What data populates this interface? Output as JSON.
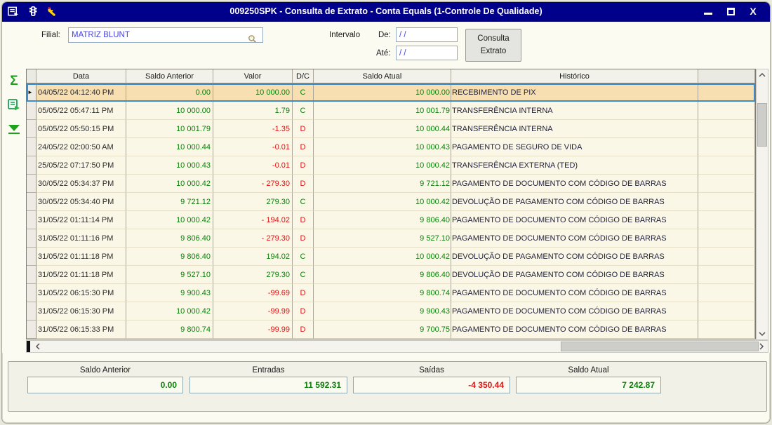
{
  "window": {
    "title": "009250SPK - Consulta de Extrato - Conta Equals (1-Controle De Qualidade)",
    "controls": {
      "close_glyph": "X"
    }
  },
  "colors": {
    "titlebar": "#00008B",
    "positive": "#0B7F0B",
    "negative": "#E01212",
    "selection": "#F7DFB2",
    "input_text": "#4743E0"
  },
  "form": {
    "filial_label": "Filial:",
    "filial_value": "MATRIZ BLUNT",
    "intervalo_label": "Intervalo",
    "de_label": "De:",
    "de_value": "/ /",
    "ate_label": "Até:",
    "ate_value": "/ /",
    "button_line1": "Consulta",
    "button_line2": "Extrato"
  },
  "table": {
    "columns": [
      "Data",
      "Saldo Anterior",
      "Valor",
      "D/C",
      "Saldo Atual",
      "Histórico"
    ],
    "rows": [
      {
        "data": "04/05/22 04:12:40 PM",
        "saldo_anterior": "0.00",
        "valor": "10 000.00",
        "dc": "C",
        "saldo_atual": "10 000.00",
        "historico": "RECEBIMENTO DE PIX",
        "selected": true
      },
      {
        "data": "05/05/22 05:47:11 PM",
        "saldo_anterior": "10 000.00",
        "valor": "1.79",
        "dc": "C",
        "saldo_atual": "10 001.79",
        "historico": "TRANSFERÊNCIA INTERNA"
      },
      {
        "data": "05/05/22 05:50:15 PM",
        "saldo_anterior": "10 001.79",
        "valor": "-1.35",
        "dc": "D",
        "saldo_atual": "10 000.44",
        "historico": "TRANSFERÊNCIA INTERNA"
      },
      {
        "data": "24/05/22 02:00:50 AM",
        "saldo_anterior": "10 000.44",
        "valor": "-0.01",
        "dc": "D",
        "saldo_atual": "10 000.43",
        "historico": "PAGAMENTO DE SEGURO DE VIDA"
      },
      {
        "data": "25/05/22 07:17:50 PM",
        "saldo_anterior": "10 000.43",
        "valor": "-0.01",
        "dc": "D",
        "saldo_atual": "10 000.42",
        "historico": "TRANSFERÊNCIA EXTERNA (TED)"
      },
      {
        "data": "30/05/22 05:34:37 PM",
        "saldo_anterior": "10 000.42",
        "valor": "- 279.30",
        "dc": "D",
        "saldo_atual": "9 721.12",
        "historico": "PAGAMENTO DE DOCUMENTO COM CÓDIGO DE BARRAS"
      },
      {
        "data": "30/05/22 05:34:40 PM",
        "saldo_anterior": "9 721.12",
        "valor": "279.30",
        "dc": "C",
        "saldo_atual": "10 000.42",
        "historico": "DEVOLUÇÃO DE PAGAMENTO COM CÓDIGO DE BARRAS"
      },
      {
        "data": "31/05/22 01:11:14 PM",
        "saldo_anterior": "10 000.42",
        "valor": "- 194.02",
        "dc": "D",
        "saldo_atual": "9 806.40",
        "historico": "PAGAMENTO DE DOCUMENTO COM CÓDIGO DE BARRAS"
      },
      {
        "data": "31/05/22 01:11:16 PM",
        "saldo_anterior": "9 806.40",
        "valor": "- 279.30",
        "dc": "D",
        "saldo_atual": "9 527.10",
        "historico": "PAGAMENTO DE DOCUMENTO COM CÓDIGO DE BARRAS"
      },
      {
        "data": "31/05/22 01:11:18 PM",
        "saldo_anterior": "9 806.40",
        "valor": "194.02",
        "dc": "C",
        "saldo_atual": "10 000.42",
        "historico": "DEVOLUÇÃO DE PAGAMENTO COM CÓDIGO DE BARRAS"
      },
      {
        "data": "31/05/22 01:11:18 PM",
        "saldo_anterior": "9 527.10",
        "valor": "279.30",
        "dc": "C",
        "saldo_atual": "9 806.40",
        "historico": "DEVOLUÇÃO DE PAGAMENTO COM CÓDIGO DE BARRAS"
      },
      {
        "data": "31/05/22 06:15:30 PM",
        "saldo_anterior": "9 900.43",
        "valor": "-99.69",
        "dc": "D",
        "saldo_atual": "9 800.74",
        "historico": "PAGAMENTO DE DOCUMENTO COM CÓDIGO DE BARRAS"
      },
      {
        "data": "31/05/22 06:15:30 PM",
        "saldo_anterior": "10 000.42",
        "valor": "-99.99",
        "dc": "D",
        "saldo_atual": "9 900.43",
        "historico": "PAGAMENTO DE DOCUMENTO COM CÓDIGO DE BARRAS"
      },
      {
        "data": "31/05/22 06:15:33 PM",
        "saldo_anterior": "9 800.74",
        "valor": "-99.99",
        "dc": "D",
        "saldo_atual": "9 700.75",
        "historico": "PAGAMENTO DE DOCUMENTO COM CÓDIGO DE BARRAS"
      }
    ]
  },
  "summary": {
    "saldo_anterior_label": "Saldo Anterior",
    "saldo_anterior_value": "0.00",
    "entradas_label": "Entradas",
    "entradas_value": "11 592.31",
    "saidas_label": "Saídas",
    "saidas_value": "-4 350.44",
    "saldo_atual_label": "Saldo Atual",
    "saldo_atual_value": "7 242.87"
  },
  "icons": {
    "titlebar": [
      "form-icon",
      "traffic-light-icon",
      "wrench-icon"
    ],
    "toolbar": [
      "sum-sigma-icon",
      "export-report-icon",
      "filter-funnel-icon"
    ],
    "lookup": "magnifier-icon"
  }
}
